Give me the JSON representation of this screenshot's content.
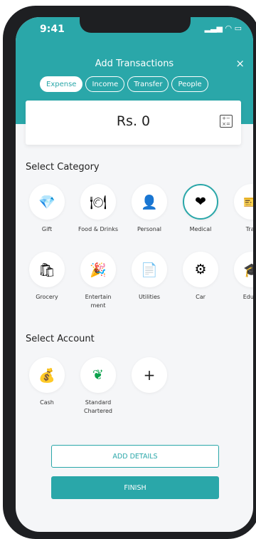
{
  "status_bar": {
    "time": "9:41"
  },
  "header": {
    "title": "Add Transactions",
    "close_label": "×",
    "tabs": [
      {
        "label": "Expense",
        "active": true
      },
      {
        "label": "Income",
        "active": false
      },
      {
        "label": "Transfer",
        "active": false
      },
      {
        "label": "People",
        "active": false
      }
    ]
  },
  "amount": {
    "value": "Rs. 0",
    "calculator_icon": "calculator-icon"
  },
  "category": {
    "title": "Select Category",
    "items": [
      {
        "label": "Gift",
        "icon": "gift-icon"
      },
      {
        "label": "Food & Drinks",
        "icon": "food-drinks-icon"
      },
      {
        "label": "Personal",
        "icon": "person-icon"
      },
      {
        "label": "Medical",
        "icon": "heartbeat-icon",
        "selected": true
      },
      {
        "label": "Trav",
        "icon": "ticket-icon"
      },
      {
        "label": "Grocery",
        "icon": "grocery-icon"
      },
      {
        "label": "Entertain ment",
        "icon": "bunting-icon"
      },
      {
        "label": "Utilities",
        "icon": "bill-icon"
      },
      {
        "label": "Car",
        "icon": "car-wheel-icon"
      },
      {
        "label": "Educa",
        "icon": "graduation-cap-icon"
      }
    ]
  },
  "account": {
    "title": "Select Account",
    "items": [
      {
        "label": "Cash",
        "icon": "money-bag-icon"
      },
      {
        "label": "Standard Chartered",
        "icon": "standard-chartered-logo"
      },
      {
        "label": "",
        "icon": "plus-icon"
      }
    ]
  },
  "actions": {
    "add_details": "ADD DETAILS",
    "finish": "FINISH"
  },
  "colors": {
    "accent": "#2aa7a9",
    "background": "#f5f6f8"
  }
}
